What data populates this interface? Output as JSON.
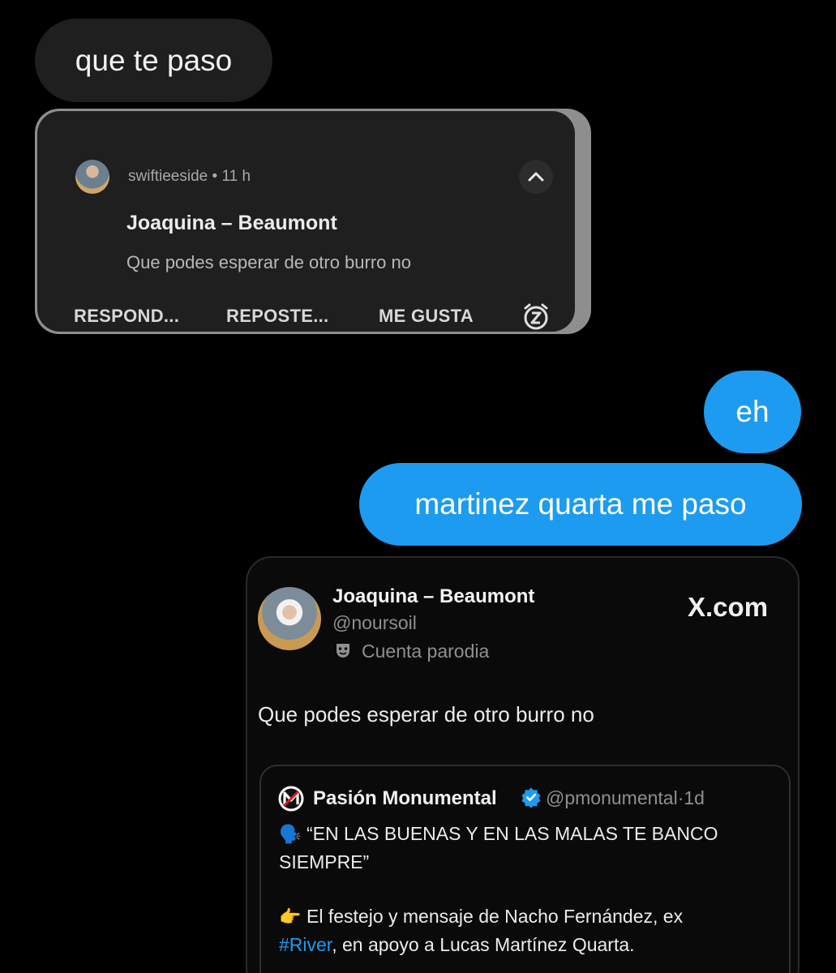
{
  "messages": {
    "incoming_1": "que te paso",
    "outgoing_1": "eh",
    "outgoing_2": "martinez quarta me paso"
  },
  "notification": {
    "username": "swiftieeside",
    "separator": "•",
    "time": "11 h",
    "title": "Joaquina – Beaumont",
    "body": "Que podes esperar de otro burro no",
    "actions": {
      "reply": "RESPOND...",
      "repost": "REPOSTE...",
      "like": "ME GUSTA"
    },
    "icons": {
      "expand": "chevron-up-icon",
      "snooze": "snooze-alarm-icon"
    }
  },
  "tweet": {
    "author_name": "Joaquina – Beaumont",
    "handle": "@noursoil",
    "parody_label": "Cuenta parodia",
    "source": "X.com",
    "text": "Que podes esperar de otro burro no",
    "quote": {
      "author_name": "Pasión Monumental",
      "handle": "@pmonumental",
      "time_sep": "·",
      "time": "1d",
      "line1_emoji": "🗣️",
      "line1": "“EN LAS BUENAS Y EN LAS MALAS TE BANCO",
      "line2": "SIEMPRE”",
      "line3_emoji": "👉",
      "line3": "El festejo y mensaje de Nacho Fernández, ex",
      "line4_hashtag": "#River",
      "line4": ", en apoyo a Lucas Martínez Quarta."
    }
  },
  "colors": {
    "background": "#000000",
    "incoming_bubble": "#1f1f1f",
    "outgoing_bubble": "#1d9bf0",
    "hashtag": "#1d9bf0",
    "verified": "#1d9bf0"
  }
}
